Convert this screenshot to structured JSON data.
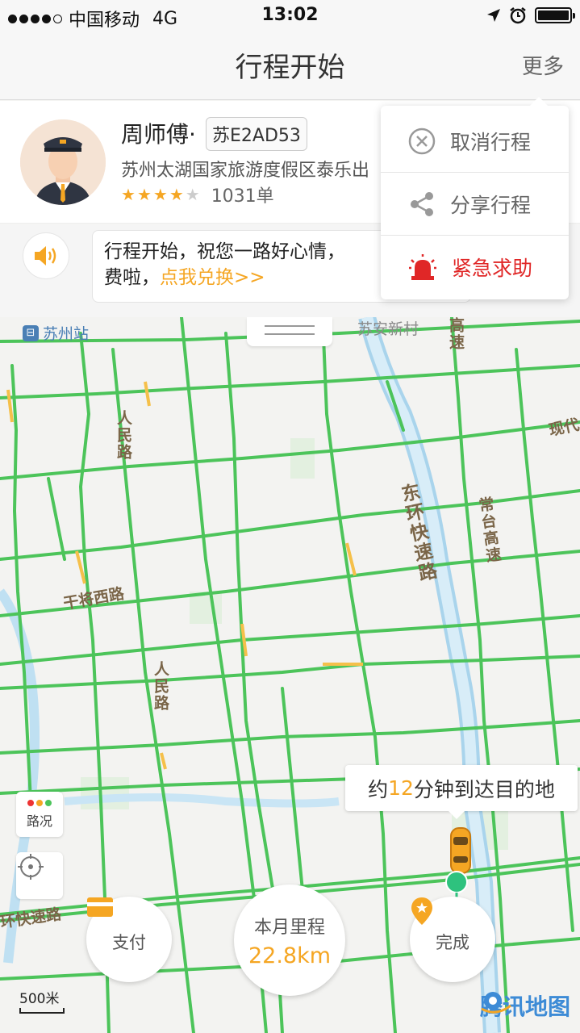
{
  "status_bar": {
    "carrier": "中国移动",
    "network": "4G",
    "time": "13:02"
  },
  "nav": {
    "title": "行程开始",
    "more_label": "更多"
  },
  "driver": {
    "name": "周师傅·",
    "plate": "苏E2AD53",
    "company": "苏州太湖国家旅游度假区泰乐出",
    "stars": 4,
    "orders": "1031单"
  },
  "message": {
    "text": "行程开始，祝您一路好心情，",
    "text_line2": "费啦，",
    "link": "点我兑换>>"
  },
  "dropdown": {
    "items": [
      {
        "label": "取消行程",
        "icon": "cancel-circle-icon"
      },
      {
        "label": "分享行程",
        "icon": "share-icon"
      },
      {
        "label": "紧急求助",
        "icon": "alarm-light-icon"
      }
    ]
  },
  "map": {
    "station": "苏州站",
    "labels": {
      "suan": "苏安新村",
      "gaosu": "高速",
      "renmin_1": "人民路",
      "renmin_2": "人民路",
      "ganjiang": "干将西路",
      "donghuan": "东环快速路",
      "changtai": "常台高速",
      "xiandai": "现代",
      "huan_kuaisu": "环快速路"
    },
    "traffic_button_label": "路况",
    "eta_prefix": "约",
    "eta_minutes": "12",
    "eta_suffix": "分钟到达目的地",
    "scale_label": "500米",
    "logo_text": "腾讯地图"
  },
  "bottom": {
    "pay_label": "支付",
    "mileage_label": "本月里程",
    "mileage_value": "22.8km",
    "finish_label": "完成"
  },
  "colors": {
    "accent": "#f5a623",
    "road": "#4cc45a",
    "danger": "#e02727"
  }
}
